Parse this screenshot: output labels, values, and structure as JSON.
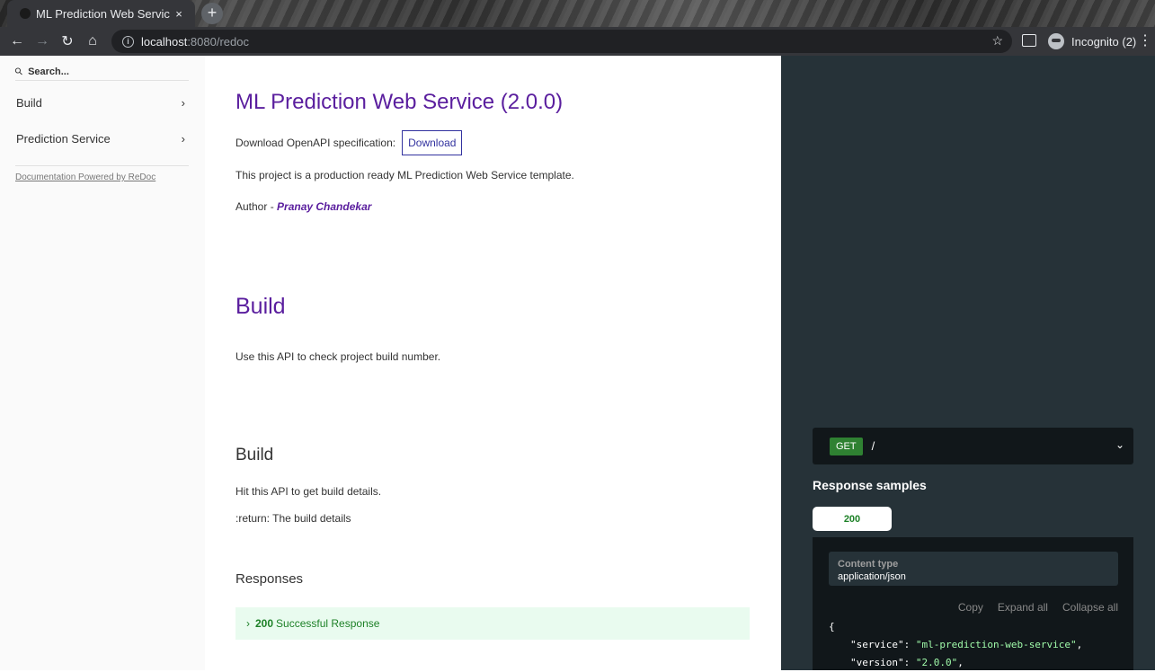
{
  "browser": {
    "tab_title": "ML Prediction Web Servic",
    "tab_close": "×",
    "new_tab": "+",
    "url_host": "localhost",
    "url_path": ":8080/redoc",
    "profile": "Incognito (2)",
    "icons": [
      "back-icon",
      "forward-icon",
      "reload-icon",
      "home-icon",
      "info-icon",
      "star-icon",
      "cast-icon",
      "incognito-icon",
      "menu-icon"
    ]
  },
  "sidebar": {
    "search_placeholder": "Search...",
    "items": [
      {
        "label": "Build",
        "chevron": "›"
      },
      {
        "label": "Prediction Service",
        "chevron": "›"
      }
    ],
    "powered_by": "Documentation Powered by ReDoc"
  },
  "main": {
    "title": "ML Prediction Web Service (2.0.0)",
    "download_label": "Download OpenAPI specification:",
    "download_button": "Download",
    "description": "This project is a production ready ML Prediction Web Service template.",
    "author_prefix": "Author - ",
    "author_name": "Pranay Chandekar",
    "section_title": "Build",
    "section_desc": "Use this API to check project build number.",
    "op_title": "Build",
    "op_desc1": "Hit this API to get build details.",
    "op_desc2": ":return: The build details",
    "responses_title": "Responses",
    "response_code": "200",
    "response_text": "Successful Response"
  },
  "right": {
    "method": "GET",
    "path": "/",
    "samples_title": "Response samples",
    "sample_tab": "200",
    "content_type_label": "Content type",
    "content_type_value": "application/json",
    "copy": "Copy",
    "expand_all": "Expand all",
    "collapse_all": "Collapse all",
    "json_open": "{",
    "json_line1_key": "\"service\"",
    "json_line1_val": "\"ml-prediction-web-service\"",
    "json_line2_key": "\"version\"",
    "json_line2_val": "\"2.0.0\""
  },
  "colors": {
    "accent": "#5a1e9e",
    "success": "#1d8127",
    "panel": "#263238"
  }
}
